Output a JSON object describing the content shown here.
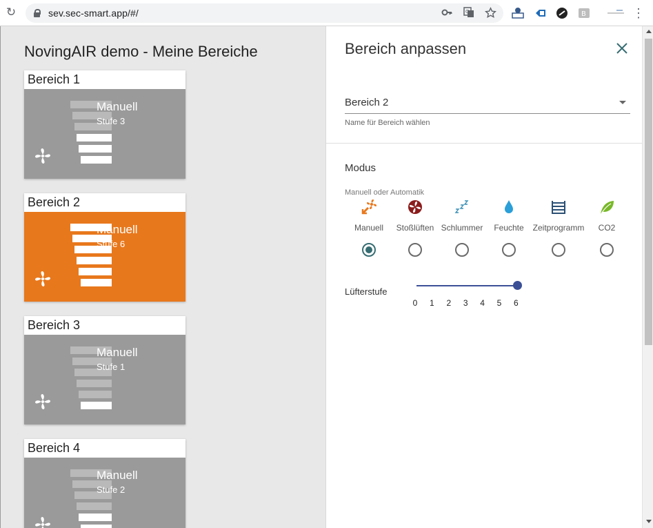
{
  "browser": {
    "url": "sev.sec-smart.app/#/",
    "icons": [
      "reload-icon",
      "lock-icon",
      "key-icon",
      "translate-icon",
      "star-icon",
      "extension-icon",
      "extension-icon",
      "extension-icon",
      "extension-icon",
      "extension-icon",
      "menu-icon"
    ]
  },
  "page": {
    "title": "NovingAIR demo - Meine Bereiche"
  },
  "areas": [
    {
      "name": "Bereich 1",
      "mode": "Manuell",
      "stufe": "Stufe 3",
      "level": 3,
      "active": false
    },
    {
      "name": "Bereich 2",
      "mode": "Manuell",
      "stufe": "Stufe 6",
      "level": 6,
      "active": true
    },
    {
      "name": "Bereich 3",
      "mode": "Manuell",
      "stufe": "Stufe 1",
      "level": 1,
      "active": false
    },
    {
      "name": "Bereich 4",
      "mode": "Manuell",
      "stufe": "Stufe 2",
      "level": 2,
      "active": false
    }
  ],
  "panel": {
    "title": "Bereich anpassen",
    "select_value": "Bereich 2",
    "select_hint": "Name für Bereich wählen",
    "modus_label": "Modus",
    "modus_hint": "Manuell oder Automatik",
    "modes": [
      {
        "label": "Manuell",
        "icon": "manual-fan-icon",
        "checked": true
      },
      {
        "label": "Stoßlüften",
        "icon": "burst-fan-icon",
        "checked": false
      },
      {
        "label": "Schlummer",
        "icon": "sleep-icon",
        "checked": false
      },
      {
        "label": "Feuchte",
        "icon": "humidity-drop-icon",
        "checked": false
      },
      {
        "label": "Zeitprogramm",
        "icon": "schedule-icon",
        "checked": false
      },
      {
        "label": "CO2",
        "icon": "leaf-icon",
        "checked": false
      }
    ],
    "fan_label": "Lüfterstufe",
    "fan_ticks": [
      "0",
      "1",
      "2",
      "3",
      "4",
      "5",
      "6"
    ],
    "fan_value": 6
  },
  "colors": {
    "accent": "#e8781c",
    "card_gray": "#9a9a9a",
    "radio": "#366d72",
    "slider": "#3b4f96"
  }
}
